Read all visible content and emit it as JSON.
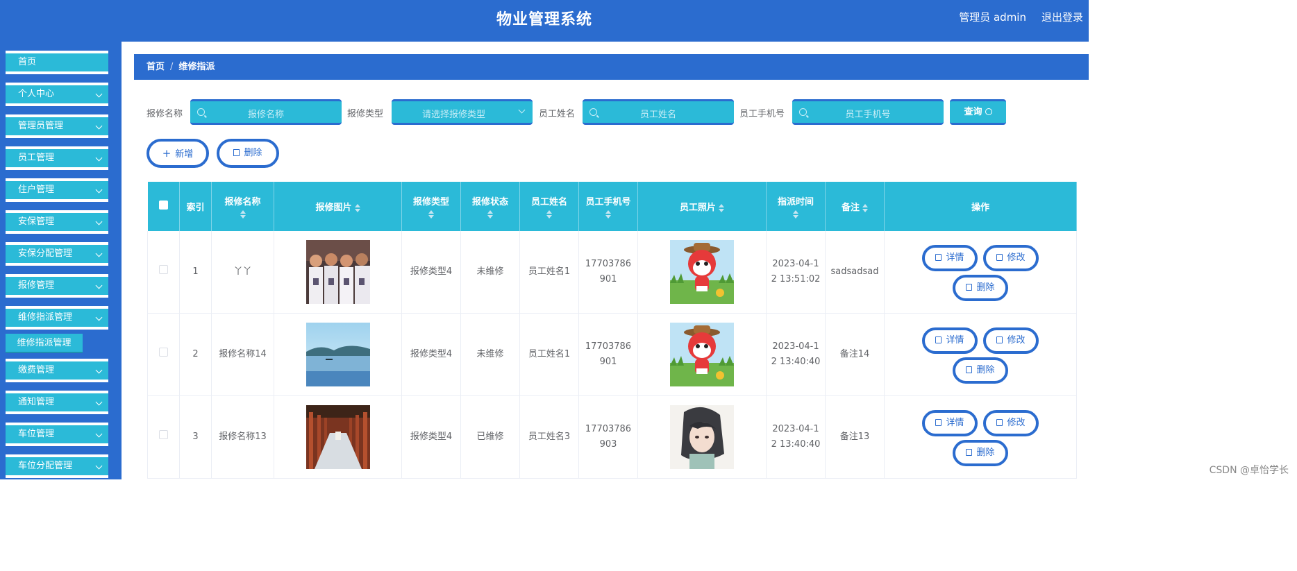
{
  "header": {
    "title": "物业管理系统",
    "user": "管理员 admin",
    "logout": "退出登录"
  },
  "sidebar": {
    "items": [
      {
        "label": "首页"
      },
      {
        "label": "个人中心"
      },
      {
        "label": "管理员管理"
      },
      {
        "label": "员工管理"
      },
      {
        "label": "住户管理"
      },
      {
        "label": "安保管理"
      },
      {
        "label": "安保分配管理"
      },
      {
        "label": "报修管理"
      },
      {
        "label": "维修指派管理"
      },
      {
        "label": "缴费管理"
      },
      {
        "label": "通知管理"
      },
      {
        "label": "车位管理"
      },
      {
        "label": "车位分配管理"
      }
    ],
    "active_sub": "维修指派管理"
  },
  "breadcrumb": {
    "home": "首页",
    "sep": "/",
    "current": "维修指派"
  },
  "search": {
    "name_label": "报修名称",
    "name_placeholder": "报修名称",
    "type_label": "报修类型",
    "type_placeholder": "请选择报修类型",
    "emp_label": "员工姓名",
    "emp_placeholder": "员工姓名",
    "phone_label": "员工手机号",
    "phone_placeholder": "员工手机号",
    "query": "查询"
  },
  "actions": {
    "add": "新增",
    "delete": "删除"
  },
  "table": {
    "headers": [
      "索引",
      "报修名称",
      "报修图片",
      "报修类型",
      "报修状态",
      "员工姓名",
      "员工手机号",
      "员工照片",
      "指派时间",
      "备注",
      "操作"
    ],
    "rows": [
      {
        "index": "1",
        "name": "丫丫",
        "type": "报修类型4",
        "status": "未维修",
        "emp": "员工姓名1",
        "phone_a": "17703786",
        "phone_b": "901",
        "time_a": "2023-04-1",
        "time_b": "2 13:51:02",
        "note": "sadsadsad",
        "img": "team-photo",
        "photo": "cartoon-fox-avatar"
      },
      {
        "index": "2",
        "name": "报修名称14",
        "type": "报修类型4",
        "status": "未维修",
        "emp": "员工姓名1",
        "phone_a": "17703786",
        "phone_b": "901",
        "time_a": "2023-04-1",
        "time_b": "2 13:40:40",
        "note": "备注14",
        "img": "lake-photo",
        "photo": "cartoon-fox-avatar"
      },
      {
        "index": "3",
        "name": "报修名称13",
        "type": "报修类型4",
        "status": "已维修",
        "emp": "员工姓名3",
        "phone_a": "17703786",
        "phone_b": "903",
        "time_a": "2023-04-1",
        "time_b": "2 13:40:40",
        "note": "备注13",
        "img": "corridor-photo",
        "photo": "anime-girl-avatar"
      }
    ],
    "op_detail": "详情",
    "op_edit": "修改",
    "op_delete": "删除"
  },
  "watermark": "CSDN @卓怡学长",
  "colors": {
    "primary": "#2b6ccf",
    "accent": "#2bbad8"
  }
}
